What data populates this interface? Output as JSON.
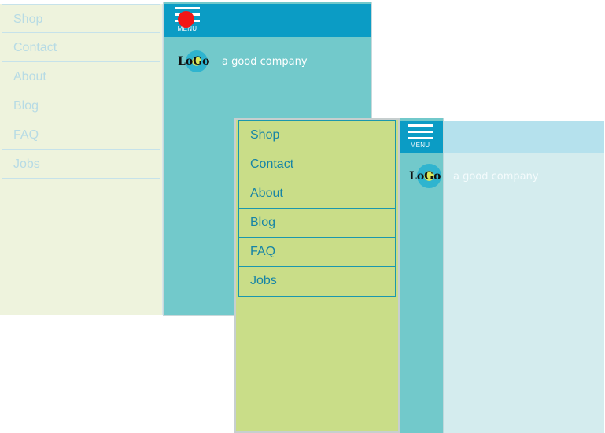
{
  "colors": {
    "accent_blue": "#0b9cc5",
    "teal": "#72c9cb",
    "sidebar_green": "#c9dd88",
    "menu_text": "#1684a6",
    "record_red": "#f21616"
  },
  "icons": {
    "menu": "hamburger-icon",
    "record": "record-dot-icon",
    "logo": "logo-circle-icon"
  },
  "screen_a": {
    "menu_items": [
      "Shop",
      "Contact",
      "About",
      "Blog",
      "FAQ",
      "Jobs"
    ],
    "menu_button_label": "MENU",
    "logo_text": "LoGo",
    "tagline": "a good company"
  },
  "screen_b": {
    "menu_items": [
      "Shop",
      "Contact",
      "About",
      "Blog",
      "FAQ",
      "Jobs"
    ],
    "menu_button_label": "MENU",
    "logo_text": "LoGo",
    "tagline": "a good company"
  }
}
